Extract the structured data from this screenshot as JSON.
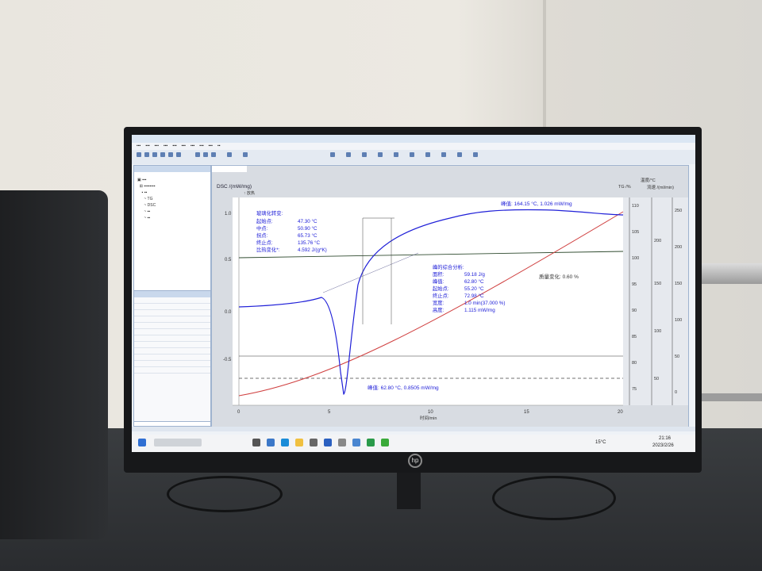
{
  "chart": {
    "y_left_label": "DSC /(mW/mg)",
    "exo_label": "↑ 放热",
    "y_left_ticks": [
      "1.0",
      "0.5",
      "0.0",
      "-0.5"
    ],
    "x_ticks": [
      "0",
      "5",
      "10",
      "15",
      "20"
    ],
    "x_label": "时间/min",
    "tg_label": "TG /%",
    "tg_ticks": [
      "110",
      "105",
      "100",
      "95",
      "90",
      "85",
      "80",
      "75"
    ],
    "temp_label": "温度/°C",
    "temp_ticks": [
      "200",
      "150",
      "100",
      "50"
    ],
    "flow_label": "流速 /(ml/min)",
    "flow_ticks": [
      "250",
      "200",
      "150",
      "100",
      "50",
      "0"
    ],
    "peak_top_label": "峰值: 164.15 °C, 1.026 mW/mg",
    "peak_bottom_label": "峰值: 62.80 °C, 0.8505 mW/mg",
    "mass_change_label": "质量变化: 0.60 %",
    "glass_transition": {
      "title": "玻璃化转变:",
      "lines": [
        {
          "k": "起始点:",
          "v": "47.30 °C"
        },
        {
          "k": "中点:",
          "v": "50.90 °C"
        },
        {
          "k": "拐点:",
          "v": "65.73 °C"
        },
        {
          "k": "终止点:",
          "v": "135.76 °C"
        },
        {
          "k": "比热变化*:",
          "v": "4.592 J/(g*K)"
        }
      ]
    },
    "peak_analysis": {
      "title": "峰的综合分析:",
      "lines": [
        {
          "k": "面积:",
          "v": "59.18 J/g"
        },
        {
          "k": "峰值:",
          "v": "62.80 °C"
        },
        {
          "k": "起始点:",
          "v": "55.20 °C"
        },
        {
          "k": "终止点:",
          "v": "72.98 °C"
        },
        {
          "k": "宽度:",
          "v": "1.0 min(37.000 %)"
        },
        {
          "k": "高度:",
          "v": "1.115 mW/mg"
        }
      ]
    }
  },
  "colors": {
    "dsc_curve": "#2020d8",
    "temperature_curve": "#d04040",
    "tg_curve": "#335533",
    "plot_bg": "#ffffff"
  },
  "taskbar": {
    "weather": "15°C",
    "time": "21:16",
    "date": "2023/2/26"
  }
}
